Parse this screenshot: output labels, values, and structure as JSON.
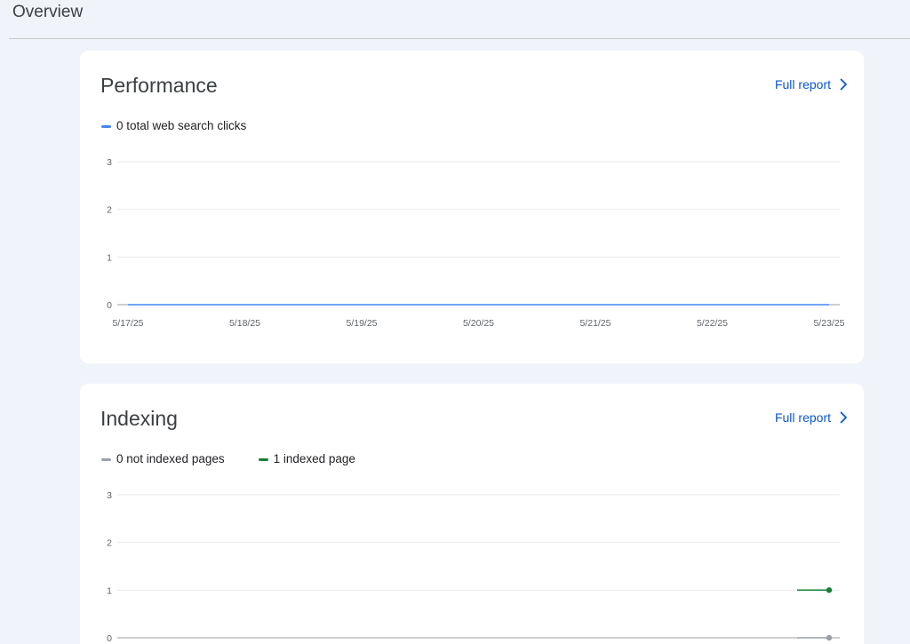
{
  "page": {
    "title": "Overview"
  },
  "colors": {
    "background": "#f0f4fa",
    "card": "#ffffff",
    "link": "#0b57d0",
    "clicks_series": "#4285f4",
    "not_indexed_series": "#9aa0a6",
    "indexed_series": "#188038",
    "gridline": "#ebebeb"
  },
  "performance": {
    "title": "Performance",
    "full_report_label": "Full report",
    "full_report_icon": "chevron-right-icon",
    "legend": [
      {
        "label": "0 total web search clicks",
        "color": "#4285f4"
      }
    ]
  },
  "indexing": {
    "title": "Indexing",
    "full_report_label": "Full report",
    "full_report_icon": "chevron-right-icon",
    "legend": [
      {
        "label": "0 not indexed pages",
        "color": "#9aa0a6"
      },
      {
        "label": "1 indexed page",
        "color": "#188038"
      }
    ]
  },
  "chart_data": [
    {
      "type": "line",
      "x": [
        "5/17/25",
        "5/18/25",
        "5/19/25",
        "5/20/25",
        "5/21/25",
        "5/22/25",
        "5/23/25"
      ],
      "yticks": [
        0,
        1,
        2,
        3
      ],
      "ylim": [
        0,
        3
      ],
      "grid": true,
      "legend_position": "top-left",
      "series": [
        {
          "name": "0 total web search clicks",
          "color": "#4285f4",
          "values": [
            0,
            0,
            0,
            0,
            0,
            0,
            0
          ]
        }
      ]
    },
    {
      "type": "line",
      "yticks": [
        0,
        1,
        2,
        3
      ],
      "ylim": [
        0,
        3
      ],
      "grid": true,
      "legend_position": "top-left",
      "series": [
        {
          "name": "0 not indexed pages",
          "color": "#9aa0a6",
          "values": [
            0,
            0
          ]
        },
        {
          "name": "1 indexed page",
          "color": "#188038",
          "values": [
            1,
            1
          ]
        }
      ]
    }
  ]
}
